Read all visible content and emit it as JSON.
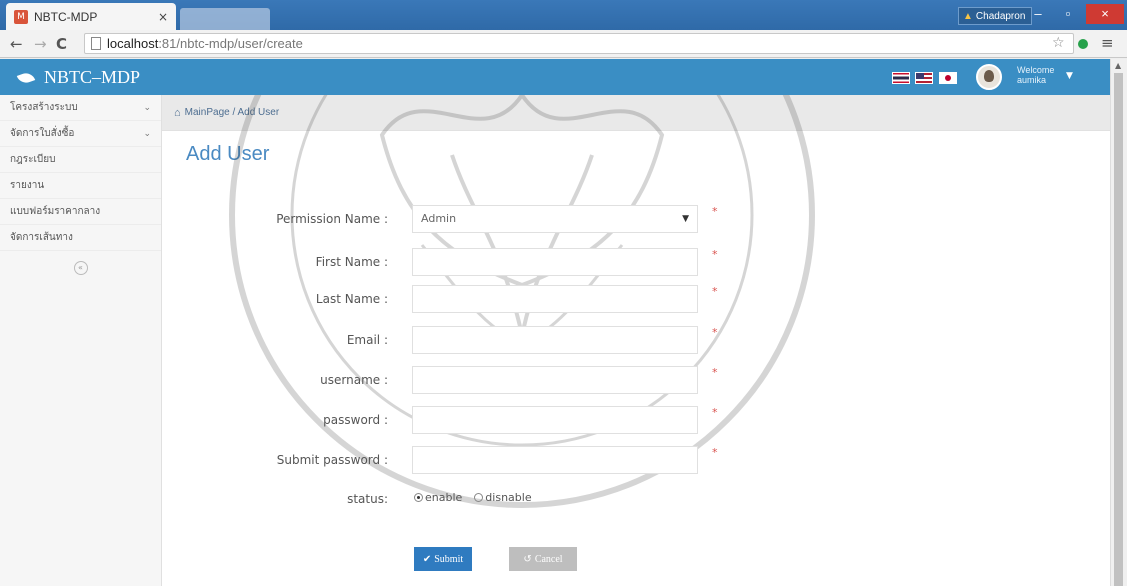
{
  "browser": {
    "tab_title": "NBTC-MDP",
    "tab_close": "×",
    "favicon": "M",
    "profile_name": "Chadapron",
    "url_host": "localhost",
    "url_path": ":81/nbtc-mdp/user/create",
    "window_min": "–",
    "window_max": "▫",
    "window_close": "×"
  },
  "header": {
    "brand": "NBTC–MDP",
    "welcome_line1": "Welcome",
    "welcome_line2": "aumika",
    "flags": [
      "thailand-flag",
      "us-flag",
      "japan-flag"
    ]
  },
  "sidebar": {
    "items": [
      {
        "label": "โครงสร้างระบบ",
        "has_submenu": true
      },
      {
        "label": "จัดการใบสั่งซื้อ",
        "has_submenu": true
      },
      {
        "label": "กฎระเบียบ",
        "has_submenu": false
      },
      {
        "label": "รายงาน",
        "has_submenu": false
      },
      {
        "label": "แบบฟอร์มราคากลาง",
        "has_submenu": false
      },
      {
        "label": "จัดการเส้นทาง",
        "has_submenu": false
      }
    ]
  },
  "breadcrumb": "MainPage / Add User",
  "page_title": "Add User",
  "form": {
    "permission_label": "Permission Name :",
    "permission_value": "Admin",
    "first_name_label": "First Name :",
    "first_name_value": "",
    "last_name_label": "Last Name :",
    "last_name_value": "",
    "email_label": "Email :",
    "email_value": "",
    "username_label": "username :",
    "username_value": "",
    "password_label": "password :",
    "password_value": "",
    "submit_password_label": "Submit password :",
    "submit_password_value": "",
    "required_mark": "*",
    "status_label": "status:",
    "status_options": [
      "enable",
      "disnable"
    ],
    "status_selected": "enable"
  },
  "buttons": {
    "submit": "Submit",
    "cancel": "Cancel"
  },
  "colors": {
    "header_blue": "#3a8ec4",
    "title_blue": "#4a8ac2",
    "required_red": "#d9534f",
    "submit_blue": "#2f7bc0"
  }
}
